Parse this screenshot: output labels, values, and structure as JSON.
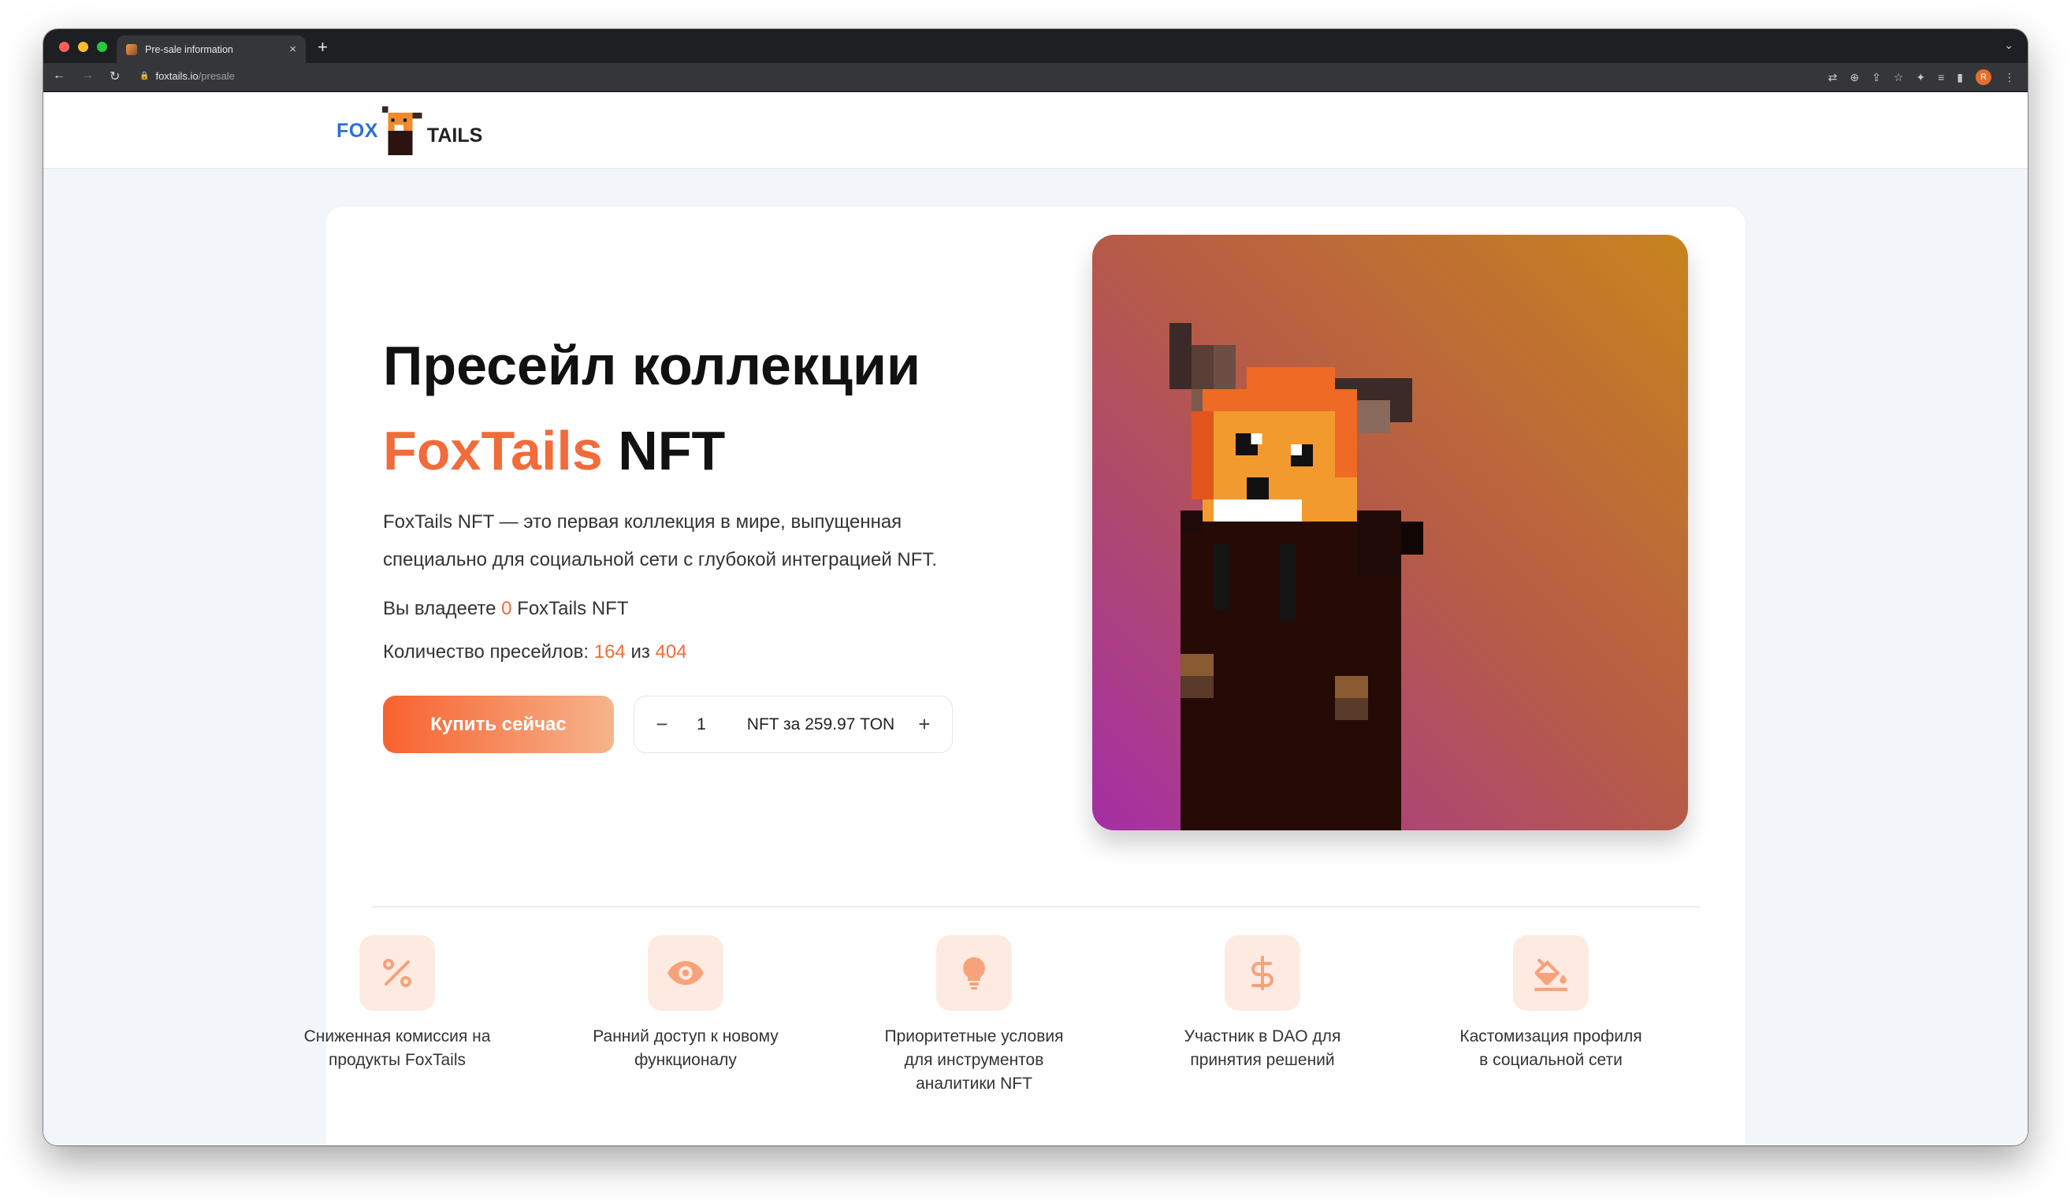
{
  "browser": {
    "tab_title": "Pre-sale information",
    "url_domain": "foxtails.io",
    "url_path": "/presale",
    "profile_initial": "R"
  },
  "logo": {
    "fox": "FOX",
    "tails": "TAILS"
  },
  "hero": {
    "title_line1": "Пресейл коллекции",
    "title_accent": "FoxTails",
    "title_nft": "NFT",
    "description": "FoxTails NFT — это первая коллекция в мире, выпущенная специально для социальной сети с глубокой интеграцией NFT.",
    "owned_prefix": "Вы владеете",
    "owned_count": "0",
    "owned_suffix": "FoxTails NFT",
    "presales_prefix": "Количество пресейлов:",
    "presales_sold": "164",
    "presales_of": "из",
    "presales_total": "404"
  },
  "purchase": {
    "buy_label": "Купить сейчас",
    "minus": "−",
    "quantity": "1",
    "price_text": "NFT за 259.97 TON",
    "plus": "+"
  },
  "features": [
    {
      "icon": "percent-icon",
      "label": "Сниженная комиссия на продукты FoxTails"
    },
    {
      "icon": "eye-icon",
      "label": "Ранний доступ к новому функционалу"
    },
    {
      "icon": "lightbulb-icon",
      "label": "Приоритетные условия для инструментов аналитики NFT"
    },
    {
      "icon": "dollar-icon",
      "label": "Участник в DAO для принятия решений"
    },
    {
      "icon": "paint-bucket-icon",
      "label": "Кастомизация профиля в социальной сети"
    }
  ],
  "colors": {
    "accent": "#f26b3a",
    "icon_bg": "#fdebe2",
    "icon_fg": "#f7a27a",
    "logo_blue": "#2a6fd6"
  }
}
